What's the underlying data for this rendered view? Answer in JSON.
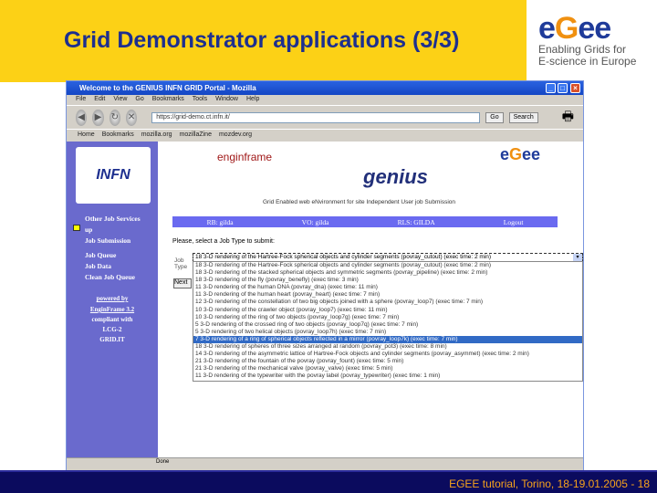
{
  "slide": {
    "title": "Grid Demonstrator applications (3/3)",
    "footer": "EGEE tutorial, Torino, 18-19.01.2005  -  18"
  },
  "logo": {
    "name": "eGee",
    "tagline1": "Enabling Grids for",
    "tagline2": "E-science in Europe"
  },
  "browser": {
    "title": "Welcome to the GENIUS INFN GRID Portal - Mozilla",
    "menu": [
      "File",
      "Edit",
      "View",
      "Go",
      "Bookmarks",
      "Tools",
      "Window",
      "Help"
    ],
    "url": "https://grid-demo.ct.infn.it/",
    "go": "Go",
    "search": "Search",
    "bookmarks": [
      "Home",
      "Bookmarks",
      "mozilla.org",
      "mozillaZine",
      "mozdev.org"
    ],
    "status": "Done"
  },
  "portal": {
    "infn": "INFN",
    "enginframe": "enginframe",
    "genius": "genius",
    "subtitle": "Grid Enabled web eNvironment for site Independent User job Submission",
    "side_menu": [
      "Other Job Services",
      "up",
      "Job Submission",
      "Job Queue",
      "Job Data",
      "Clean Job Queue"
    ],
    "credits": [
      "powered by",
      "EnginFrame 3.2",
      "compliant with",
      "LCG-2",
      "GRID.IT"
    ],
    "bar": [
      "RB: gilda",
      "VO: gilda",
      "RLS: GILDA",
      "Logout"
    ],
    "prompt": "Please, select a Job Type to submit:",
    "job_label": "Job Type",
    "next": "Next",
    "selected": "18 3-D rendering of the Hartree-Fock spherical objects and cylinder segments (povray_cutout) (exec time: 2 min)",
    "options": [
      "18 3-D rendering of the Hartree-Fock spherical objects and cylinder segments (povray_cutout) (exec time: 2 min)",
      "18 3-D rendering of the stacked spherical objects and symmetric segments (povray_pipeline) (exec time: 2 min)",
      "18 3-D rendering of the fly (povray_benefly) (exec time: 3 min)",
      "11 3-D rendering of the human DNA (povray_dna) (exec time: 11 min)",
      "11 3-D rendering of the human heart (povray_heart) (exec time: 7 min)",
      "12 3-D rendering of the constellation of two big objects joined with a sphere (povray_loop7) (exec time: 7 min)",
      "10 3-D rendering of the crawler object (povray_loop7) (exec time: 11 min)",
      "10 3-D rendering of the ring of two objects (povray_loop7g) (exec time: 7 min)",
      "5 3-D rendering of the crossed ring of two objects (povray_loop7q) (exec time: 7 min)",
      "5 3-D rendering of two helical objects (povray_loop7h) (exec time: 7 min)",
      "7 3-D rendering of a ring of spherical objects reflected in a mirror (povray_loop7k) (exec time: 7 min)",
      "18 3-D rendering of spheres of three sizes arranged at random (povray_pot3) (exec time: 8 min)",
      "14 3-D rendering of the asymmetric lattice of Hartree-Fock objects and cylinder segments (povray_asymmet) (exec time: 2 min)",
      "21 3-D rendering of the fountain of the povray (povray_fount) (exec time: 5 min)",
      "21 3-D rendering of the mechanical valve (povray_valve) (exec time: 5 min)",
      "11 3-D rendering of the typewriter with the povray label (povray_typewriter) (exec time: 1 min)"
    ],
    "selected_index": 10
  }
}
